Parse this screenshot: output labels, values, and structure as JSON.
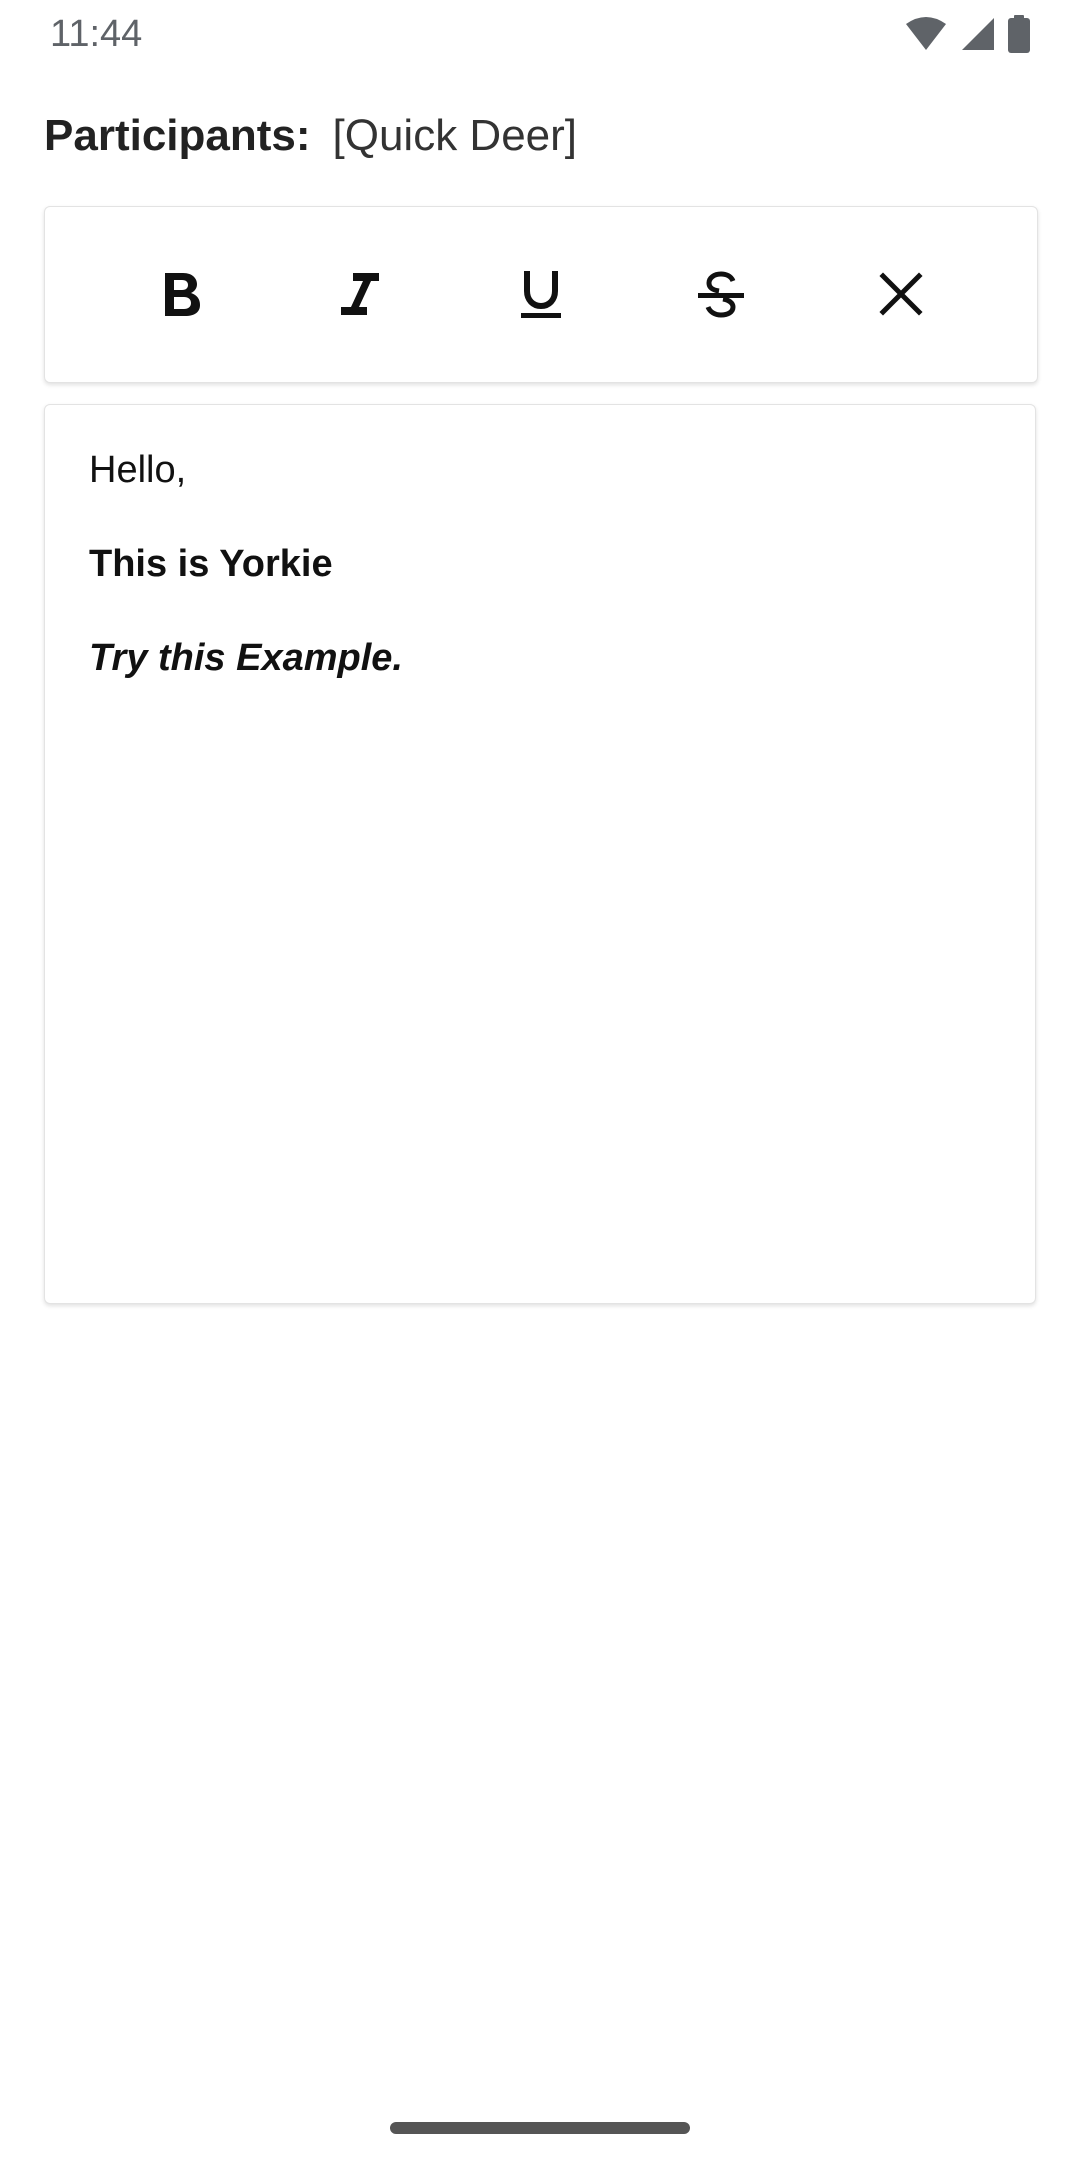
{
  "status_bar": {
    "time": "11:44",
    "icons": [
      "wifi-icon",
      "cellular-signal-icon",
      "battery-icon"
    ]
  },
  "participants": {
    "label": "Participants:",
    "value": "[Quick Deer]"
  },
  "toolbar": {
    "buttons": [
      {
        "name": "bold",
        "icon": "bold-icon"
      },
      {
        "name": "italic",
        "icon": "italic-icon"
      },
      {
        "name": "underline",
        "icon": "underline-icon"
      },
      {
        "name": "strikethrough",
        "icon": "strikethrough-icon"
      },
      {
        "name": "clear-formatting",
        "icon": "close-icon"
      }
    ]
  },
  "editor": {
    "lines": [
      {
        "text": "Hello,",
        "style": "normal"
      },
      {
        "text": "This is Yorkie",
        "style": "bold"
      },
      {
        "text": "Try this Example.",
        "style": "bold-italic"
      }
    ]
  },
  "colors": {
    "background": "#ffffff",
    "text": "#111111",
    "status_text": "#5f6368",
    "card_border": "#e3e3e3"
  }
}
